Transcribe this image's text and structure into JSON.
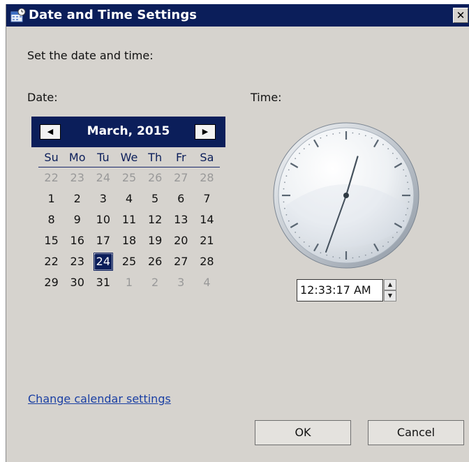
{
  "window": {
    "title": "Date and Time Settings",
    "close_glyph": "✕"
  },
  "prompt": "Set the date and time:",
  "date_label": "Date:",
  "time_label": "Time:",
  "calendar": {
    "month_title": "March, 2015",
    "prev_glyph": "◀",
    "next_glyph": "▶",
    "weekdays": [
      "Su",
      "Mo",
      "Tu",
      "We",
      "Th",
      "Fr",
      "Sa"
    ],
    "weeks": [
      [
        {
          "d": "22",
          "o": true
        },
        {
          "d": "23",
          "o": true
        },
        {
          "d": "24",
          "o": true
        },
        {
          "d": "25",
          "o": true
        },
        {
          "d": "26",
          "o": true
        },
        {
          "d": "27",
          "o": true
        },
        {
          "d": "28",
          "o": true
        }
      ],
      [
        {
          "d": "1"
        },
        {
          "d": "2"
        },
        {
          "d": "3"
        },
        {
          "d": "4"
        },
        {
          "d": "5"
        },
        {
          "d": "6"
        },
        {
          "d": "7"
        }
      ],
      [
        {
          "d": "8"
        },
        {
          "d": "9"
        },
        {
          "d": "10"
        },
        {
          "d": "11"
        },
        {
          "d": "12"
        },
        {
          "d": "13"
        },
        {
          "d": "14"
        }
      ],
      [
        {
          "d": "15"
        },
        {
          "d": "16"
        },
        {
          "d": "17"
        },
        {
          "d": "18"
        },
        {
          "d": "19"
        },
        {
          "d": "20"
        },
        {
          "d": "21"
        }
      ],
      [
        {
          "d": "22"
        },
        {
          "d": "23"
        },
        {
          "d": "24",
          "sel": true
        },
        {
          "d": "25"
        },
        {
          "d": "26"
        },
        {
          "d": "27"
        },
        {
          "d": "28"
        }
      ],
      [
        {
          "d": "29"
        },
        {
          "d": "30"
        },
        {
          "d": "31"
        },
        {
          "d": "1",
          "o": true
        },
        {
          "d": "2",
          "o": true
        },
        {
          "d": "3",
          "o": true
        },
        {
          "d": "4",
          "o": true
        }
      ]
    ]
  },
  "clock": {
    "hour": 12,
    "minute": 33,
    "second": 17
  },
  "time_value": "12:33:17 AM",
  "spin": {
    "up": "▲",
    "down": "▼"
  },
  "link_text": "Change calendar settings",
  "buttons": {
    "ok": "OK",
    "cancel": "Cancel"
  },
  "colors": {
    "titlebar": "#0b1e5a",
    "dialog_bg": "#d6d3ce",
    "selected": "#0b1e5a",
    "link": "#1a3fa3"
  }
}
